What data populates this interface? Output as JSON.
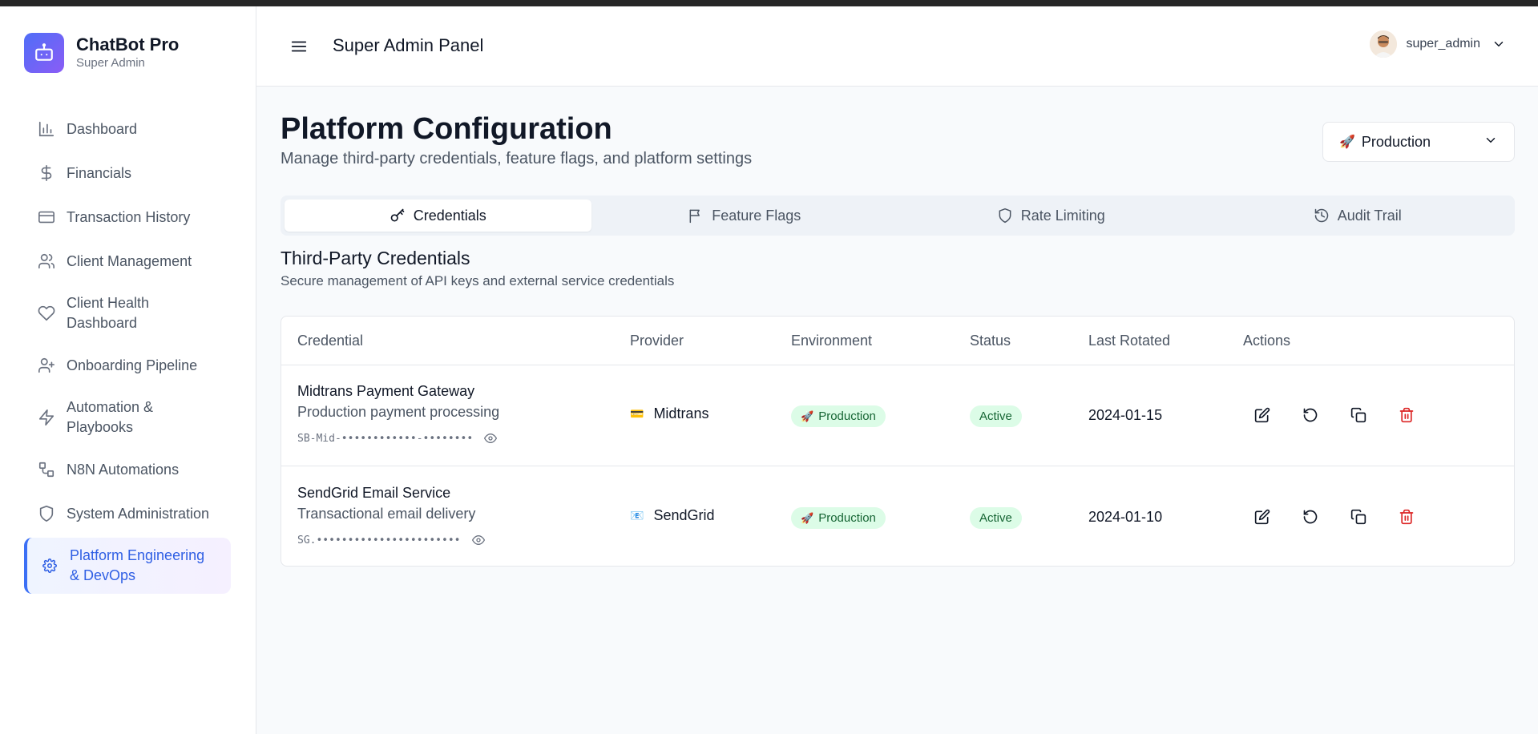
{
  "brand": {
    "name": "ChatBot Pro",
    "subtitle": "Super Admin"
  },
  "sidebar": {
    "items": [
      {
        "label": "Dashboard",
        "icon": "bar-chart-icon"
      },
      {
        "label": "Financials",
        "icon": "dollar-icon"
      },
      {
        "label": "Transaction History",
        "icon": "credit-card-icon"
      },
      {
        "label": "Client Management",
        "icon": "users-icon"
      },
      {
        "label": "Client Health Dashboard",
        "icon": "heart-icon"
      },
      {
        "label": "Onboarding Pipeline",
        "icon": "user-plus-icon"
      },
      {
        "label": "Automation & Playbooks",
        "icon": "zap-icon"
      },
      {
        "label": "N8N Automations",
        "icon": "workflow-icon"
      },
      {
        "label": "System Administration",
        "icon": "shield-icon"
      },
      {
        "label": "Platform Engineering & DevOps",
        "icon": "gear-icon",
        "active": true
      }
    ]
  },
  "header": {
    "title": "Super Admin Panel",
    "username": "super_admin"
  },
  "main": {
    "title": "Platform Configuration",
    "subtitle": "Manage third-party credentials, feature flags, and platform settings",
    "environment_select": {
      "emoji": "🚀",
      "value": "Production"
    },
    "tabs": [
      {
        "label": "Credentials",
        "icon": "key-icon",
        "active": true
      },
      {
        "label": "Feature Flags",
        "icon": "flag-icon"
      },
      {
        "label": "Rate Limiting",
        "icon": "shield-icon"
      },
      {
        "label": "Audit Trail",
        "icon": "history-icon"
      }
    ],
    "section": {
      "title": "Third-Party Credentials",
      "subtitle": "Secure management of API keys and external service credentials"
    },
    "table": {
      "columns": [
        "Credential",
        "Provider",
        "Environment",
        "Status",
        "Last Rotated",
        "Actions"
      ],
      "rows": [
        {
          "name": "Midtrans Payment Gateway",
          "description": "Production payment processing",
          "masked_key": "SB-Mid-••••••••••••-••••••••",
          "provider": "Midtrans",
          "provider_emoji": "💳",
          "environment": "Production",
          "environment_emoji": "🚀",
          "status": "Active",
          "last_rotated": "2024-01-15"
        },
        {
          "name": "SendGrid Email Service",
          "description": "Transactional email delivery",
          "masked_key": "SG.•••••••••••••••••••••••",
          "provider": "SendGrid",
          "provider_emoji": "📧",
          "environment": "Production",
          "environment_emoji": "🚀",
          "status": "Active",
          "last_rotated": "2024-01-10"
        }
      ]
    }
  },
  "colors": {
    "accent": "#3b6ff5",
    "success_bg": "#dcfce7",
    "success_text": "#166534",
    "danger": "#dc2626"
  }
}
